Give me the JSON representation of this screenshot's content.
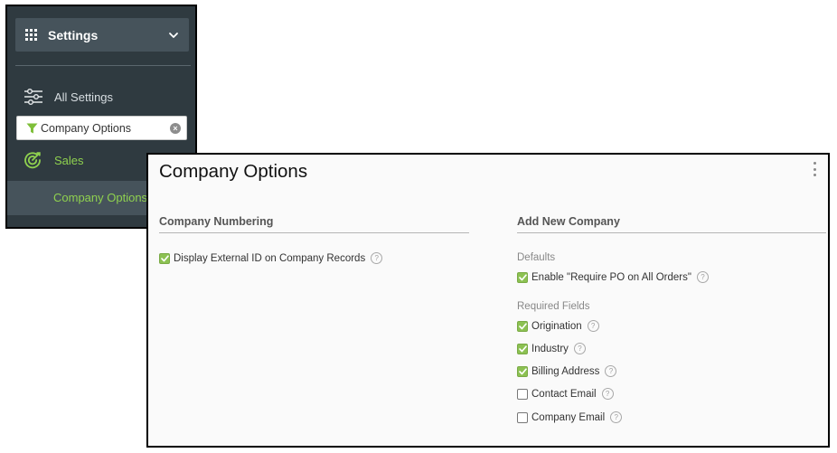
{
  "sidebar": {
    "header_title": "Settings",
    "all_settings_label": "All Settings",
    "filter": {
      "value": "Company Options",
      "placeholder": "Company Options"
    },
    "sales_label": "Sales",
    "active_item_label": "Company Options"
  },
  "main": {
    "title": "Company Options",
    "company_numbering": {
      "title": "Company Numbering",
      "options": [
        {
          "label": "Display External ID on Company Records",
          "checked": true
        }
      ]
    },
    "add_new_company": {
      "title": "Add New Company",
      "defaults_label": "Defaults",
      "defaults": [
        {
          "label": "Enable \"Require PO on All Orders\"",
          "checked": true
        }
      ],
      "required_fields_label": "Required Fields",
      "required_fields": [
        {
          "label": "Origination",
          "checked": true
        },
        {
          "label": "Industry",
          "checked": true
        },
        {
          "label": "Billing Address",
          "checked": true
        },
        {
          "label": "Contact Email",
          "checked": false
        },
        {
          "label": "Company Email",
          "checked": false
        }
      ]
    }
  },
  "colors": {
    "sidebar_bg": "#2f3a40",
    "sidebar_header_bg": "#46535b",
    "accent_green": "#8fd14f",
    "checkbox_green": "#8cc152"
  },
  "icons": {
    "header": "grid-icon",
    "dropdown": "chevron-down-icon",
    "all_settings": "sliders-icon",
    "filter": "funnel-icon",
    "clear": "clear-icon",
    "sales": "target-icon",
    "more": "more-vertical-icon",
    "help": "help-icon"
  }
}
